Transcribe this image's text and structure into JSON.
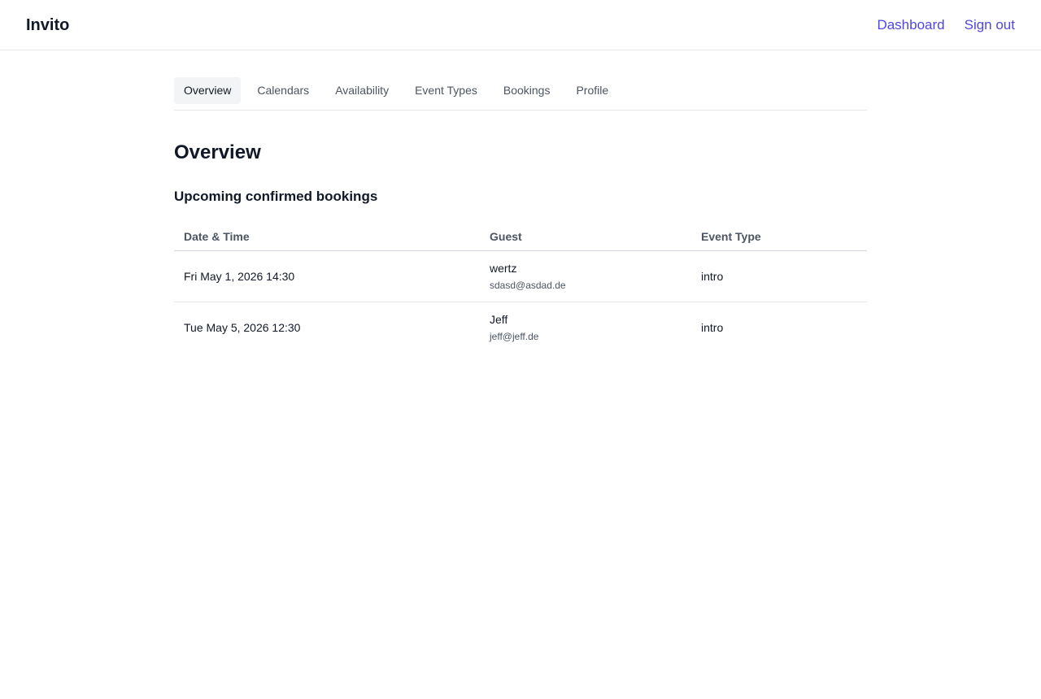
{
  "app": {
    "brand": "Invito"
  },
  "topnav": {
    "dashboard": "Dashboard",
    "sign_out": "Sign out"
  },
  "tabs": [
    {
      "label": "Overview",
      "active": true
    },
    {
      "label": "Calendars",
      "active": false
    },
    {
      "label": "Availability",
      "active": false
    },
    {
      "label": "Event Types",
      "active": false
    },
    {
      "label": "Bookings",
      "active": false
    },
    {
      "label": "Profile",
      "active": false
    }
  ],
  "main": {
    "title": "Overview",
    "section_title": "Upcoming confirmed bookings",
    "table": {
      "headers": {
        "date_time": "Date & Time",
        "guest": "Guest",
        "event_type": "Event Type"
      },
      "rows": [
        {
          "date_time": "Fri May 1, 2026 14:30",
          "guest_name": "wertz",
          "guest_email": "sdasd@asdad.de",
          "event_type": "intro"
        },
        {
          "date_time": "Tue May 5, 2026 12:30",
          "guest_name": "Jeff",
          "guest_email": "jeff@jeff.de",
          "event_type": "intro"
        }
      ]
    }
  },
  "colors": {
    "accent": "#4f46e5",
    "text": "#111827",
    "muted": "#4b5563",
    "border": "#e5e7eb",
    "active_tab_bg": "#f3f4f6"
  }
}
